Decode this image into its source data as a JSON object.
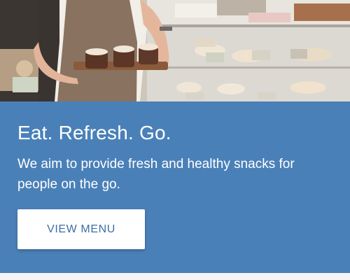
{
  "hero": {
    "image_description_icon": "bakery-counter-photo",
    "colors": {
      "apron": "#8a7260",
      "counter_glass": "#d6d2cc",
      "pastry": "#5a3424",
      "frosting": "#f1e6d8"
    }
  },
  "promo": {
    "title": "Eat. Refresh. Go.",
    "text": "We aim to provide fresh and healthy snacks for people on the go.",
    "button_label": "VIEW MENU",
    "colors": {
      "background": "#4a80b8",
      "button_text": "#3d6ea6",
      "button_background": "#ffffff"
    }
  }
}
